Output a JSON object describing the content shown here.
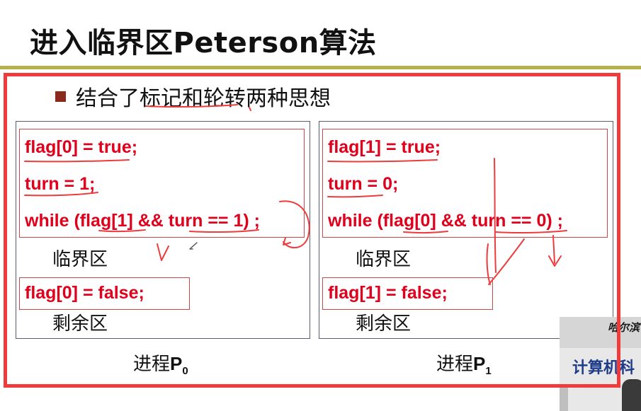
{
  "slide": {
    "title": "进入临界区Peterson算法",
    "bullet": "结合了标记和轮转两种思想"
  },
  "p0": {
    "line1": "flag[0] = true;",
    "line2": "turn = 1;",
    "line3": "while (flag[1] && turn == 1) ;",
    "critical": "临界区",
    "exit": "flag[0] = false;",
    "remainder": "剩余区",
    "label_prefix": "进程",
    "label_symbol": "P",
    "label_sub": "0"
  },
  "p1": {
    "line1": "flag[1] = true;",
    "line2": "turn = 0;",
    "line3": "while (flag[0] && turn == 0) ;",
    "critical": "临界区",
    "exit": "flag[1] = false;",
    "remainder": "剩余区",
    "label_prefix": "进程",
    "label_symbol": "P",
    "label_sub": "1"
  },
  "video": {
    "sign_line1": "哈尔滨",
    "sign_line2": "计算机科"
  },
  "colors": {
    "code_red": "#e0001b",
    "annotation_red": "#ef3b3b",
    "title_rule": "#b3b34a",
    "bullet": "#8a2a1c"
  }
}
